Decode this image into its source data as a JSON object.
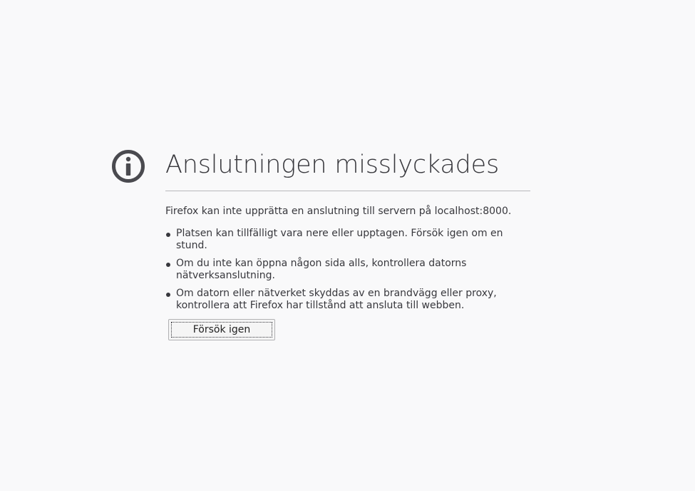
{
  "error": {
    "title": "Anslutningen misslyckades",
    "description": "Firefox kan inte upprätta en anslutning till servern på localhost:8000.",
    "bullets": [
      "Platsen kan tillfälligt vara nere eller upptagen. Försök igen om en stund.",
      "Om du inte kan öppna någon sida alls, kontrollera datorns nätverksanslutning.",
      "Om datorn eller nätverket skyddas av en brandvägg eller proxy, kontrollera att Firefox har tillstånd att ansluta till webben."
    ],
    "retry_label": "Försök igen",
    "icon": "info-icon"
  },
  "colors": {
    "background": "#f9f9fa",
    "text": "#38383d",
    "icon": "#4a4a4f",
    "divider": "#b8b8bb"
  }
}
